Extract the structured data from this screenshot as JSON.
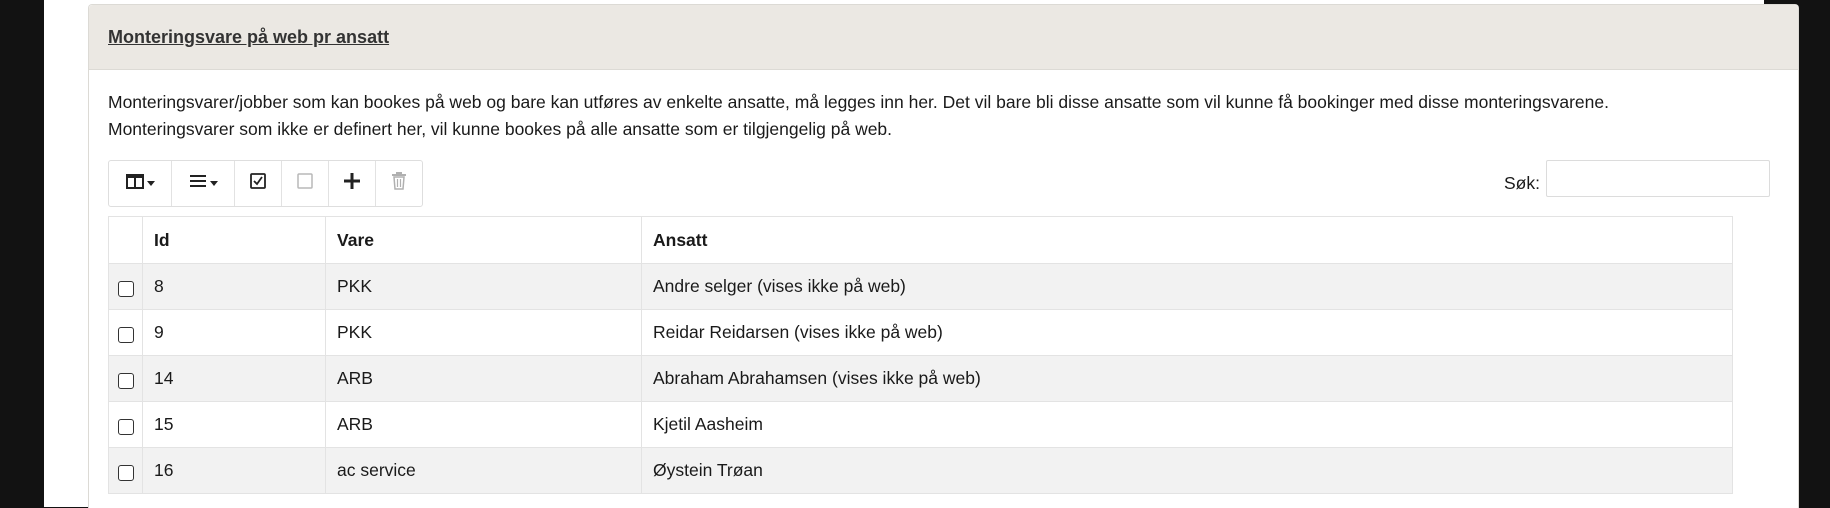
{
  "panel": {
    "title": "Monteringsvare på web pr ansatt",
    "description": [
      "Monteringsvarer/jobber som kan bookes på web og bare kan utføres av enkelte ansatte, må legges inn her. Det vil bare bli disse ansatte som vil kunne få bookinger med disse monteringsvarene.",
      "Monteringsvarer som ikke er definert her, vil kunne bookes på alle ansatte som er tilgjengelig på web."
    ]
  },
  "toolbar": {
    "buttons": [
      {
        "icon": "columns-icon",
        "has_dropdown": true
      },
      {
        "icon": "list-icon",
        "has_dropdown": true
      },
      {
        "icon": "check-all-icon"
      },
      {
        "icon": "uncheck-all-icon",
        "disabled": true
      },
      {
        "icon": "plus-icon"
      },
      {
        "icon": "trash-icon",
        "disabled": true
      }
    ]
  },
  "search": {
    "label": "Søk:",
    "value": ""
  },
  "table": {
    "headers": [
      "Id",
      "Vare",
      "Ansatt"
    ],
    "rows": [
      {
        "id": "8",
        "vare": "PKK",
        "ansatt": "Andre selger (vises ikke på web)"
      },
      {
        "id": "9",
        "vare": "PKK",
        "ansatt": "Reidar Reidarsen (vises ikke på web)"
      },
      {
        "id": "14",
        "vare": "ARB",
        "ansatt": "Abraham Abrahamsen (vises ikke på web)"
      },
      {
        "id": "15",
        "vare": "ARB",
        "ansatt": "Kjetil Aasheim"
      },
      {
        "id": "16",
        "vare": "ac service",
        "ansatt": "Øystein Trøan"
      }
    ]
  },
  "colors": {
    "background": "#121212",
    "panel_header": "#ebe8e3",
    "row_stripe": "#f2f2f2",
    "disabled_icon": "#b0b0b0"
  }
}
